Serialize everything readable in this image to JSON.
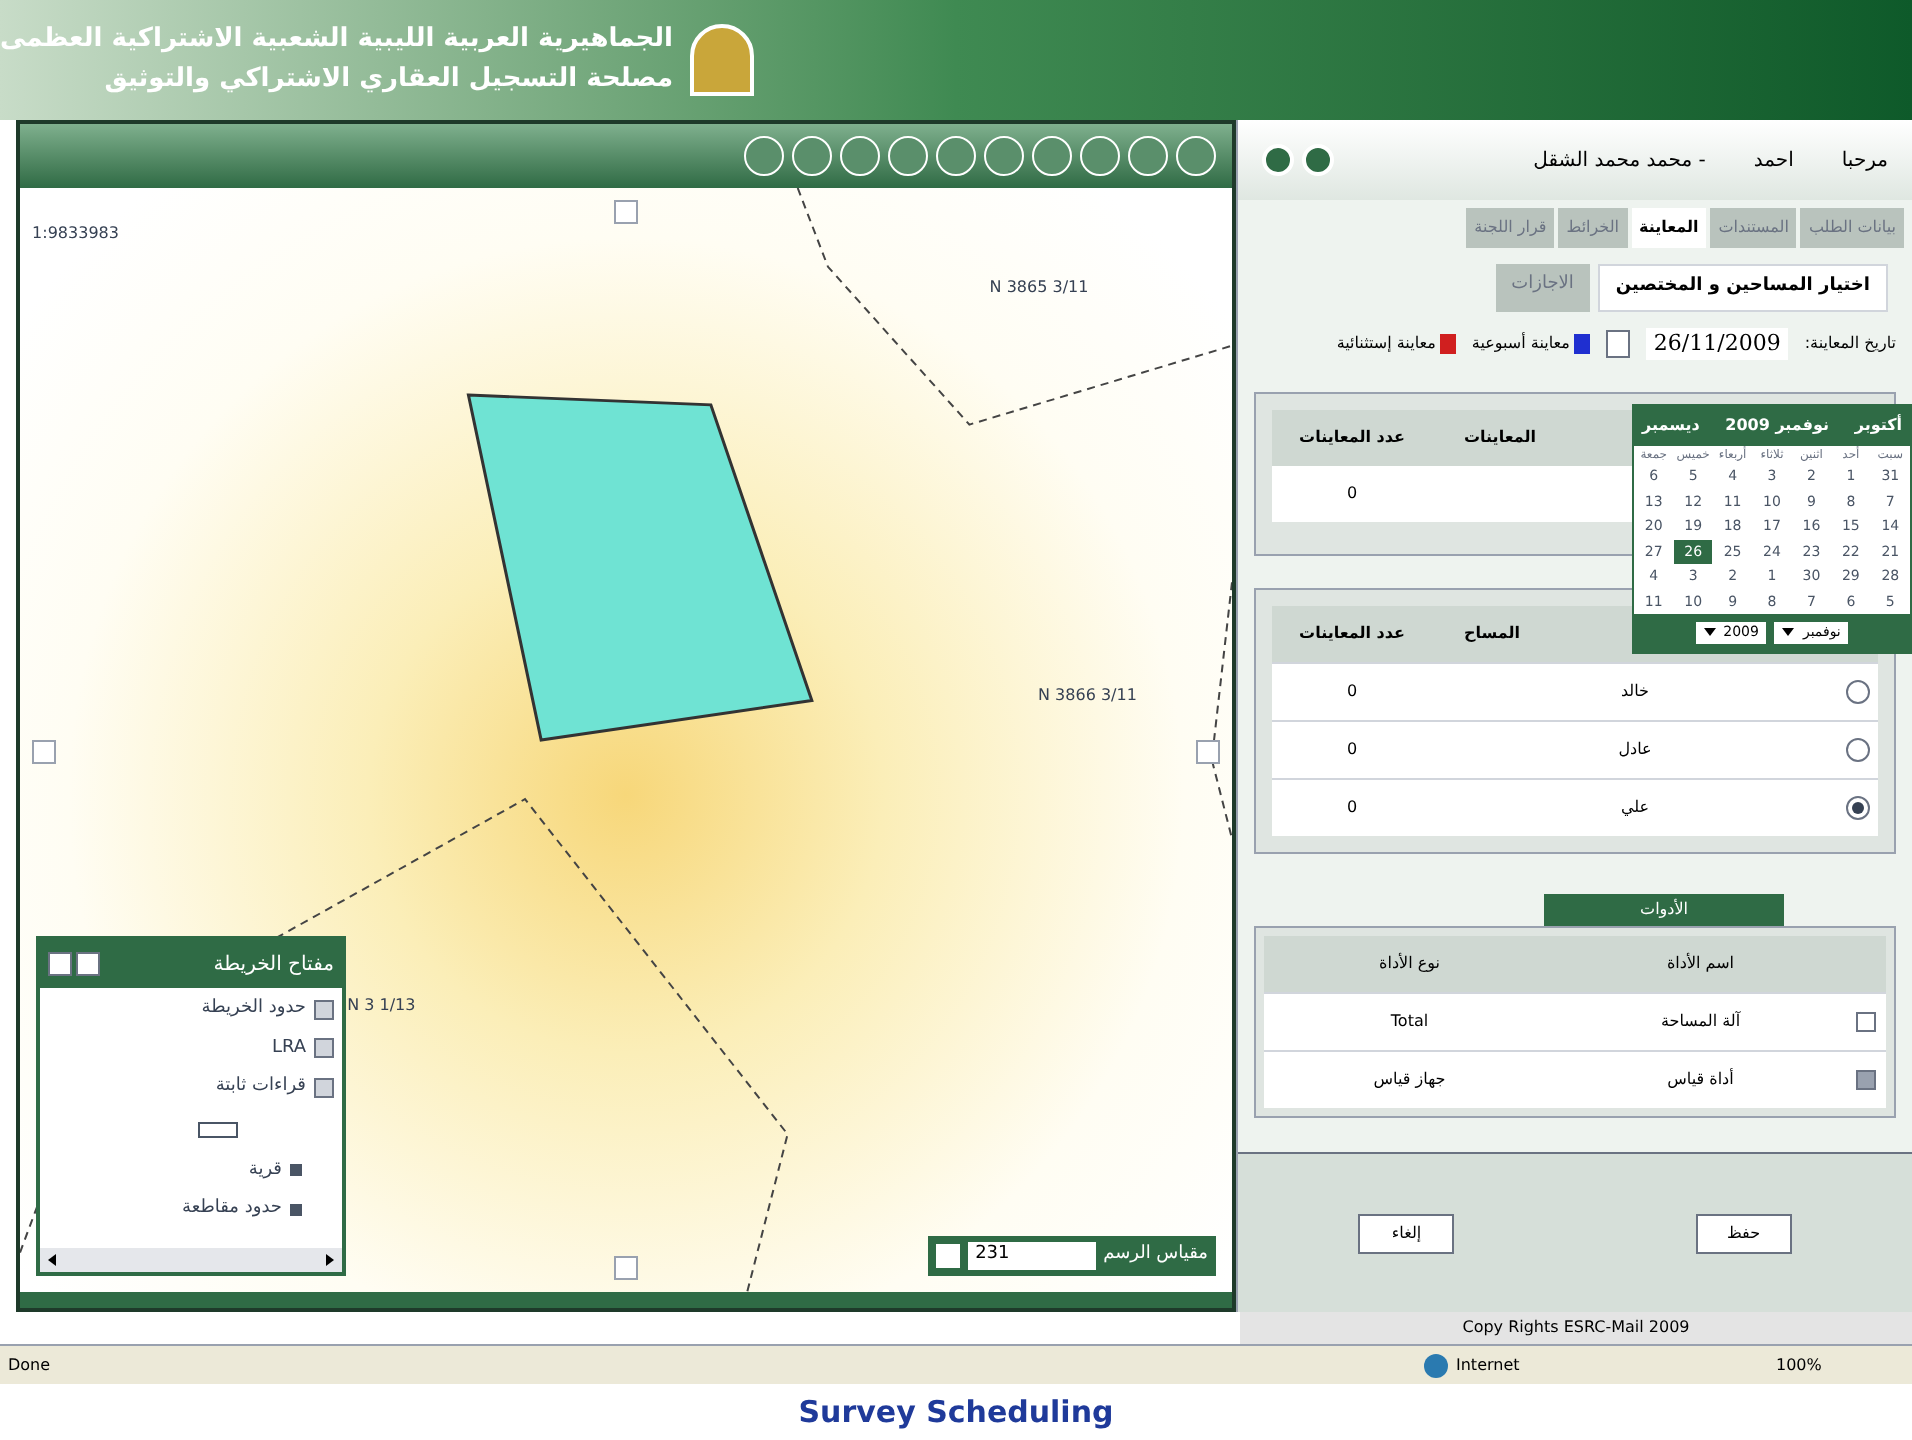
{
  "header": {
    "title_line1": "الجماهيرية العربية الليبية الشعبية الاشتراكية العظمى",
    "title_line2": "مصلحة التسجيل العقاري الاشتراكي والتوثيق"
  },
  "map": {
    "labels": [
      "1:9833983",
      "N 3865 3/11",
      "N 3866 3/11",
      "N 3 1/13"
    ],
    "legend": {
      "title": "مفتاح الخريطة",
      "items": [
        {
          "kind": "check",
          "label": "حدود الخريطة",
          "checked": true
        },
        {
          "kind": "check",
          "label": "LRA",
          "checked": true
        },
        {
          "kind": "check",
          "label": "قراءات ثابتة",
          "checked": true
        },
        {
          "kind": "swatch"
        },
        {
          "kind": "dot",
          "label": "قرية"
        },
        {
          "kind": "dot",
          "label": "حدود مقاطعة"
        }
      ]
    },
    "scale": {
      "label": "مقياس الرسم",
      "value": "231"
    }
  },
  "user_bar": {
    "greeting": "مرحبا",
    "user": "احمد",
    "name": "- محمد محمد الشقل"
  },
  "tabs": [
    {
      "label": "بيانات الطلب",
      "selected": false
    },
    {
      "label": "المستندات",
      "selected": false
    },
    {
      "label": "المعاينة",
      "selected": true
    },
    {
      "label": "الخرائط",
      "selected": false
    },
    {
      "label": "قرار اللجنة",
      "selected": false
    }
  ],
  "subtabs": [
    {
      "label": "اختيار المساحين و المختصين",
      "selected": true
    },
    {
      "label": "الاجازات",
      "selected": false
    }
  ],
  "date_field": {
    "label": "تاريخ المعاينة:",
    "value": "26/11/2009"
  },
  "legend_keys": [
    {
      "label": "معاينة أسبوعية",
      "color": "#1f2fd0"
    },
    {
      "label": "معاينة إستثنائية",
      "color": "#d01f1f"
    }
  ],
  "calendar": {
    "prev": "أكتوبر",
    "month": "نوفمبر 2009",
    "next": "ديسمبر",
    "weekdays": [
      "سبت",
      "أحد",
      "اثنين",
      "ثلاثاء",
      "أربعاء",
      "خميس",
      "جمعة"
    ],
    "days": [
      [
        {
          "day": "31",
          "selected": false
        },
        {
          "day": "1",
          "selected": false
        },
        {
          "day": "2",
          "selected": false
        },
        {
          "day": "3",
          "selected": false
        },
        {
          "day": "4",
          "selected": false
        },
        {
          "day": "5",
          "selected": false
        },
        {
          "day": "6",
          "selected": false
        }
      ],
      [
        {
          "day": "7",
          "selected": false
        },
        {
          "day": "8",
          "selected": false
        },
        {
          "day": "9",
          "selected": false
        },
        {
          "day": "10",
          "selected": false
        },
        {
          "day": "11",
          "selected": false
        },
        {
          "day": "12",
          "selected": false
        },
        {
          "day": "13",
          "selected": false
        }
      ],
      [
        {
          "day": "14",
          "selected": false
        },
        {
          "day": "15",
          "selected": false
        },
        {
          "day": "16",
          "selected": false
        },
        {
          "day": "17",
          "selected": false
        },
        {
          "day": "18",
          "selected": false
        },
        {
          "day": "19",
          "selected": false
        },
        {
          "day": "20",
          "selected": false
        }
      ],
      [
        {
          "day": "21",
          "selected": false
        },
        {
          "day": "22",
          "selected": false
        },
        {
          "day": "23",
          "selected": false
        },
        {
          "day": "24",
          "selected": false
        },
        {
          "day": "25",
          "selected": false
        },
        {
          "day": "26",
          "selected": true
        },
        {
          "day": "27",
          "selected": false
        }
      ],
      [
        {
          "day": "28",
          "selected": false
        },
        {
          "day": "29",
          "selected": false
        },
        {
          "day": "30",
          "selected": false
        },
        {
          "day": "1",
          "selected": false
        },
        {
          "day": "2",
          "selected": false
        },
        {
          "day": "3",
          "selected": false
        },
        {
          "day": "4",
          "selected": false
        }
      ],
      [
        {
          "day": "5",
          "selected": false
        },
        {
          "day": "6",
          "selected": false
        },
        {
          "day": "7",
          "selected": false
        },
        {
          "day": "8",
          "selected": false
        },
        {
          "day": "9",
          "selected": false
        },
        {
          "day": "10",
          "selected": false
        },
        {
          "day": "11",
          "selected": false
        }
      ]
    ],
    "month_select": "نوفمبر",
    "year_select": "2009"
  },
  "table1": {
    "columns": [
      "المعاينات",
      "عدد المعاينات"
    ],
    "rows": [
      [
        "",
        "0"
      ]
    ]
  },
  "table2": {
    "columns": [
      "المساح",
      "عدد المعاينات"
    ],
    "rows": [
      {
        "name": "خالد",
        "count": "0",
        "selected": false
      },
      {
        "name": "عادل",
        "count": "0",
        "selected": false
      },
      {
        "name": "علي",
        "count": "0",
        "selected": true
      }
    ]
  },
  "tools": {
    "title": "الأدوات",
    "columns": [
      "اسم الأداة",
      "نوع الأداة"
    ],
    "rows": [
      {
        "name": "آلة المساحة",
        "type": "Total",
        "checked": false
      },
      {
        "name": "أداة قياس",
        "type": "جهاز قياس",
        "checked": true
      }
    ]
  },
  "buttons": [
    "حفظ",
    "إلغاء"
  ],
  "footer": "Copy Rights ESRC-Mail 2009",
  "status_bar": {
    "left": "Done",
    "zone": "Internet",
    "zoom": "100%"
  },
  "caption": "Survey Scheduling"
}
